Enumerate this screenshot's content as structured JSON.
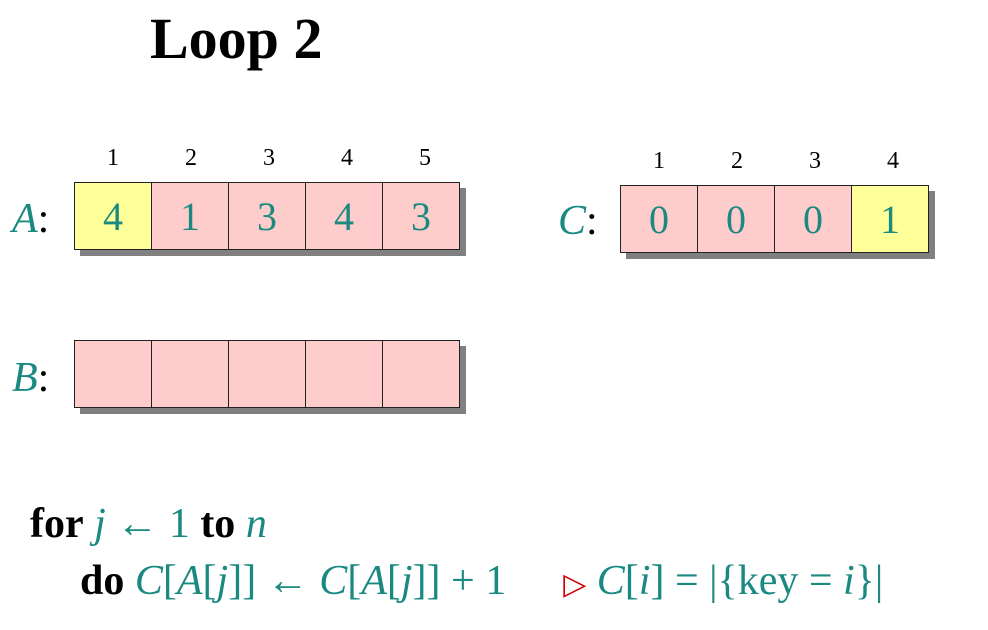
{
  "title": "Loop 2",
  "array_a": {
    "label": "A",
    "colon": ":",
    "indices": [
      "1",
      "2",
      "3",
      "4",
      "5"
    ],
    "values": [
      "4",
      "1",
      "3",
      "4",
      "3"
    ],
    "highlight": [
      true,
      false,
      false,
      false,
      false
    ]
  },
  "array_c": {
    "label": "C",
    "colon": ":",
    "indices": [
      "1",
      "2",
      "3",
      "4"
    ],
    "values": [
      "0",
      "0",
      "0",
      "1"
    ],
    "highlight": [
      false,
      false,
      false,
      true
    ]
  },
  "array_b": {
    "label": "B",
    "colon": ":",
    "values": [
      "",
      "",
      "",
      "",
      ""
    ]
  },
  "colors": {
    "cell_fill": "#ffcccc",
    "highlight_fill": "#ffff99",
    "text_teal": "#1a8a80",
    "comment_red": "#cc0000"
  },
  "code": {
    "line1": {
      "for_kw": "for",
      "var_j": "j",
      "arrow": "←",
      "one": "1",
      "to_kw": "to",
      "var_n": "n"
    },
    "line2": {
      "do_kw": "do",
      "c1": "C",
      "lb1": "[",
      "a1": "A",
      "lb2": "[",
      "j1": "j",
      "rb1": "]]",
      "arrow": "←",
      "c2": "C",
      "lb3": "[",
      "a2": "A",
      "lb4": "[",
      "j2": "j",
      "rb2": "]] + 1",
      "tri": "▷",
      "c3": "C",
      "lb5": "[",
      "i1": "i",
      "rb3": "] = |{key = ",
      "i2": "i",
      "rb4": "}|"
    }
  }
}
